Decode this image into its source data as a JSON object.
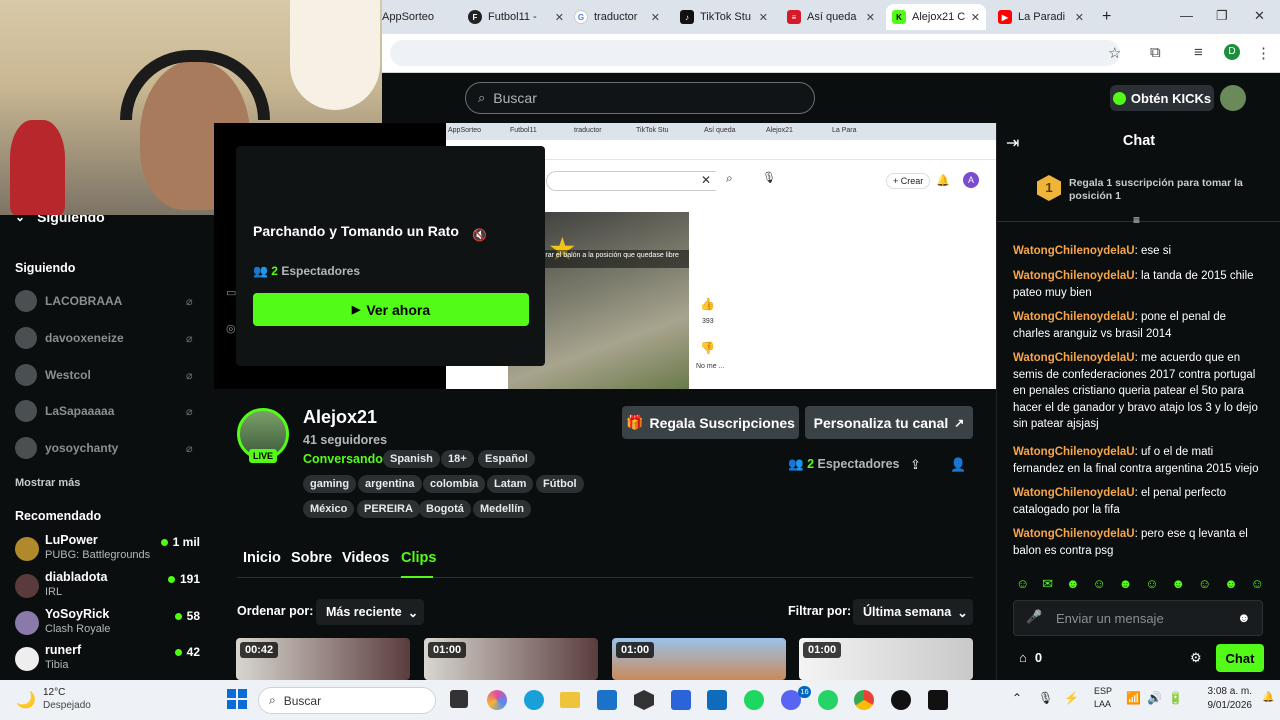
{
  "browser": {
    "tabs": [
      {
        "label": "AppSorteo",
        "color": "#5b7cf7"
      },
      {
        "label": "Futbol11 -",
        "color": "#222222"
      },
      {
        "label": "traductor",
        "color": "#4285f4"
      },
      {
        "label": "TikTok Stu",
        "color": "#111111"
      },
      {
        "label": "Así queda",
        "color": "#d51b2a"
      },
      {
        "label": "Alejox21 C",
        "color": "#53fc18"
      },
      {
        "label": "La Paradi",
        "color": "#ff0000"
      }
    ],
    "profile_initial": "D"
  },
  "header": {
    "search_placeholder": "Buscar",
    "kicks_label": "Obtén KICKs"
  },
  "sidebar": {
    "following_header": "Siguiendo",
    "following_title": "Siguiendo",
    "following": [
      {
        "name": "LACOBRAAA"
      },
      {
        "name": "davooxeneize"
      },
      {
        "name": "Westcol"
      },
      {
        "name": "LaSapaaaaa"
      },
      {
        "name": "yosoychanty"
      }
    ],
    "show_more": "Mostrar más",
    "recommended_title": "Recomendado",
    "recommended": [
      {
        "name": "LuPower",
        "category": "PUBG: Battlegrounds",
        "viewers": "1 mil"
      },
      {
        "name": "diabladota",
        "category": "IRL",
        "viewers": "191"
      },
      {
        "name": "YoSoyRick",
        "category": "Clash Royale",
        "viewers": "58"
      },
      {
        "name": "runerf",
        "category": "Tibia",
        "viewers": "42"
      }
    ]
  },
  "player": {
    "inner_tabs": [
      "AppSorteo",
      "Futbol11",
      "traductor",
      "TikTok Stu",
      "Así queda",
      "Alejox21",
      "La Para"
    ],
    "inner_create": "Crear",
    "inner_avatar": "A",
    "inner_like_count": "393",
    "inner_caption": "lado y así tirar el balón a la posición que quedase libre esto la",
    "inner_no_me": "No me ...",
    "popup_title": "Parchando y Tomando un Rato",
    "popup_viewers_count": "2",
    "popup_viewers_label": "Espectadores",
    "watch_button": "Ver ahora"
  },
  "channel": {
    "name": "Alejox21",
    "followers": "41 seguidores",
    "live_badge": "LIVE",
    "category": "Conversando",
    "tags_row1": [
      "Spanish",
      "18+",
      "Español"
    ],
    "tags_row2": [
      "gaming",
      "argentina",
      "colombia",
      "Latam",
      "Fútbol"
    ],
    "tags_row3": [
      "México",
      "PEREIRA",
      "Bogotá",
      "Medellín"
    ],
    "gift_button": "Regala Suscripciones",
    "customize_button": "Personaliza tu canal",
    "viewers_count": "2",
    "viewers_label": "Espectadores",
    "tabs": [
      "Inicio",
      "Sobre",
      "Videos",
      "Clips"
    ],
    "active_tab": "Clips",
    "sort_label": "Ordenar por:",
    "sort_value": "Más reciente",
    "filter_label": "Filtrar por:",
    "filter_value": "Última semana",
    "clips": [
      {
        "duration": "00:42"
      },
      {
        "duration": "01:00"
      },
      {
        "duration": "01:00"
      },
      {
        "duration": "01:00"
      }
    ]
  },
  "chat": {
    "title": "Chat",
    "gift_rank": "1",
    "gift_banner": "Regala 1 suscripción para tomar la posición 1",
    "messages": [
      {
        "user": "WatongChilenoydelaU",
        "text": "ese si"
      },
      {
        "user": "WatongChilenoydelaU",
        "text": "la tanda de 2015 chile pateo muy bien"
      },
      {
        "user": "WatongChilenoydelaU",
        "text": "pone el penal de charles aranguiz vs brasil 2014"
      },
      {
        "user": "WatongChilenoydelaU",
        "text": "me acuerdo que en semis de confederaciones 2017 contra portugal en penales cristiano queria patear el 5to para hacer el de ganador y bravo atajo los 3 y lo dejo sin patear ajsjasj"
      },
      {
        "user": "WatongChilenoydelaU",
        "text": "uf o el de mati fernandez en la final contra argentina 2015 viejo"
      },
      {
        "user": "WatongChilenoydelaU",
        "text": "el penal perfecto catalogado por la fifa"
      },
      {
        "user": "WatongChilenoydelaU",
        "text": "pero ese q levanta el balon es contra psg"
      }
    ],
    "input_placeholder": "Enviar un mensaje",
    "kicks_count": "0",
    "send_button": "Chat"
  },
  "taskbar": {
    "weather_temp": "12°C",
    "weather_desc": "Despejado",
    "search_label": "Buscar",
    "lang_top": "ESP",
    "lang_bottom": "LAA",
    "time": "3:08 a. m.",
    "date": "9/01/2026",
    "discord_badge": "16"
  }
}
